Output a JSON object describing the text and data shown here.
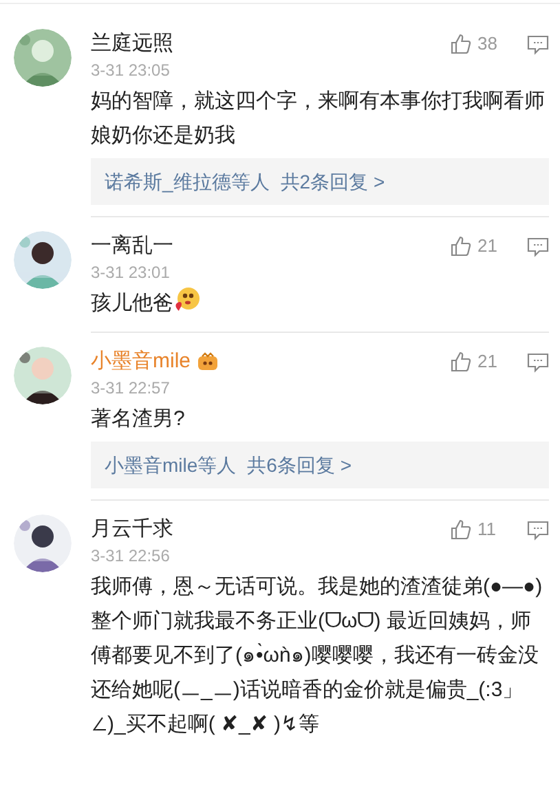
{
  "comments": [
    {
      "name": "兰庭远照",
      "member": false,
      "time": "3-31 23:05",
      "likes": "38",
      "body": "妈的智障，就这四个字，来啊有本事你打我啊看师娘奶你还是奶我",
      "emoji": false,
      "replies": {
        "users": "诺希斯_维拉德等人",
        "count": "共2条回复 >"
      }
    },
    {
      "name": "一离乱一",
      "member": false,
      "time": "3-31 23:01",
      "likes": "21",
      "body": "孩儿他爸",
      "emoji": true
    },
    {
      "name": "小墨音mile",
      "member": true,
      "time": "3-31 22:57",
      "likes": "21",
      "body": "著名渣男?",
      "emoji": false,
      "replies": {
        "users": "小墨音mile等人",
        "count": "共6条回复 >"
      }
    },
    {
      "name": "月云千求",
      "member": false,
      "time": "3-31 22:56",
      "likes": "11",
      "body": "我师傅，恩～无话可说。我是她的渣渣徒弟(●—●)整个师门就我最不务正业(ᗜωᗜ) 最近回姨妈，师傅都要见不到了(๑•̀ωǹ๑)嘤嘤嘤，我还有一砖金没还给她呢(ㅡ_ㅡ)话说暗香的金价就是偏贵_(:3」∠)_买不起啊( ✘_✘ )↯等",
      "emoji": false
    }
  ]
}
